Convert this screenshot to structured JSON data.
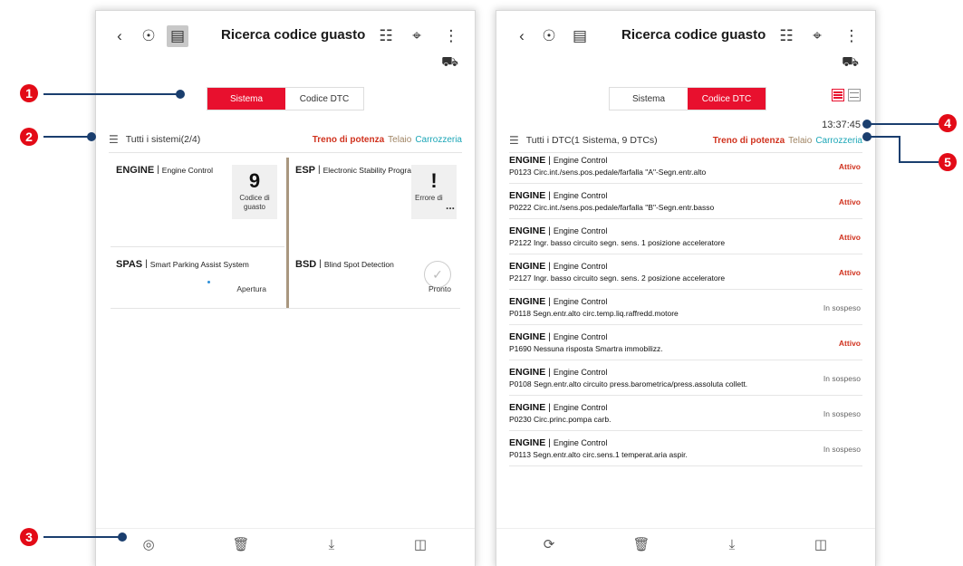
{
  "left": {
    "title": "Ricerca codice guasto",
    "tabs": [
      {
        "label": "Sistema",
        "active": true
      },
      {
        "label": "Codice DTC",
        "active": false
      }
    ],
    "filter_label": "Tutti i sistemi(2/4)",
    "filter_tabs": [
      "Treno di potenza",
      "Telaio",
      "Carrozzeria"
    ],
    "cards": [
      {
        "system": "ENGINE",
        "desc": "Engine Control",
        "stat_number": "9",
        "stat_label": "Codice di guasto"
      },
      {
        "system": "ESP",
        "desc": "Electronic Stability Program",
        "stat_number": "!",
        "stat_label": "Errore di",
        "more": "..."
      },
      {
        "system": "SPAS",
        "desc": "Smart Parking Assist System",
        "stat_label": "Apertura"
      },
      {
        "system": "BSD",
        "desc": "Blind Spot Detection",
        "stat_label": "Pronto"
      }
    ]
  },
  "right": {
    "title": "Ricerca codice guasto",
    "tabs": [
      {
        "label": "Sistema",
        "active": false
      },
      {
        "label": "Codice DTC",
        "active": true
      }
    ],
    "timestamp": "13:37:45",
    "filter_label": "Tutti i DTC(1 Sistema, 9 DTCs)",
    "filter_tabs": [
      "Treno di potenza",
      "Telaio",
      "Carrozzeria"
    ],
    "dtcs": [
      {
        "system": "ENGINE",
        "sub": "Engine Control",
        "desc": "P0123 Circ.int./sens.pos.pedale/farfalla \"A\"-Segn.entr.alto",
        "status": "Attivo"
      },
      {
        "system": "ENGINE",
        "sub": "Engine Control",
        "desc": "P0222 Circ.int./sens.pos.pedale/farfalla \"B\"-Segn.entr.basso",
        "status": "Attivo"
      },
      {
        "system": "ENGINE",
        "sub": "Engine Control",
        "desc": "P2122 Ingr. basso circuito segn. sens. 1 posizione acceleratore",
        "status": "Attivo"
      },
      {
        "system": "ENGINE",
        "sub": "Engine Control",
        "desc": "P2127 Ingr. basso circuito segn. sens. 2 posizione acceleratore",
        "status": "Attivo"
      },
      {
        "system": "ENGINE",
        "sub": "Engine Control",
        "desc": "P0118 Segn.entr.alto circ.temp.liq.raffredd.motore",
        "status": "In sospeso"
      },
      {
        "system": "ENGINE",
        "sub": "Engine Control",
        "desc": "P1690 Nessuna risposta Smartra immobilizz.",
        "status": "Attivo"
      },
      {
        "system": "ENGINE",
        "sub": "Engine Control",
        "desc": "P0108 Segn.entr.alto circuito press.barometrica/press.assoluta collett.",
        "status": "In sospeso"
      },
      {
        "system": "ENGINE",
        "sub": "Engine Control",
        "desc": "P0230 Circ.princ.pompa carb.",
        "status": "In sospeso"
      },
      {
        "system": "ENGINE",
        "sub": "Engine Control",
        "desc": "P0113 Segn.entr.alto circ.sens.1 temperat.aria aspir.",
        "status": "In sospeso"
      }
    ]
  },
  "callouts": [
    "1",
    "2",
    "3",
    "4",
    "5"
  ],
  "colors": {
    "accent": "#e8102e",
    "power": "#d0321e",
    "chassis": "#a08564",
    "body": "#1ca6b7",
    "callout": "#e30b17",
    "callout_line": "#1a3e6e"
  }
}
